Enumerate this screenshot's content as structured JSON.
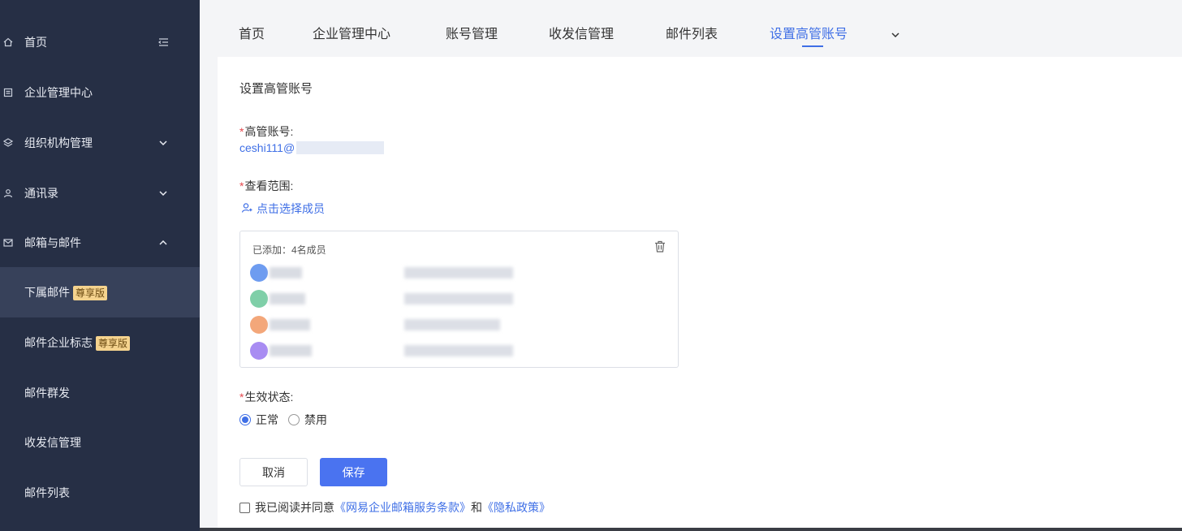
{
  "sidebar": {
    "items": [
      {
        "label": "首页",
        "icon": "home-icon",
        "right_icon": "menu-collapse-icon"
      },
      {
        "label": "企业管理中心",
        "icon": "document-icon"
      },
      {
        "label": "组织机构管理",
        "icon": "layers-icon",
        "right_icon": "chevron-down-icon"
      },
      {
        "label": "通讯录",
        "icon": "contacts-icon",
        "right_icon": "chevron-down-icon"
      },
      {
        "label": "邮箱与邮件",
        "icon": "mail-icon",
        "right_icon": "chevron-up-icon"
      }
    ],
    "sub_items": [
      {
        "label": "下属邮件",
        "badge": "尊享版",
        "active": true
      },
      {
        "label": "邮件企业标志",
        "badge": "尊享版"
      },
      {
        "label": "邮件群发"
      },
      {
        "label": "收发信管理"
      },
      {
        "label": "邮件列表"
      }
    ]
  },
  "tabs": {
    "items": [
      "首页",
      "企业管理中心",
      "账号管理",
      "收发信管理",
      "邮件列表",
      "设置高管账号"
    ],
    "active": "设置高管账号"
  },
  "form": {
    "page_title": "设置高管账号",
    "required_mark": "*",
    "exec_account_label": "高管账号:",
    "exec_account_value": "ceshi111@",
    "view_scope_label": "查看范围:",
    "select_members_link": "点击选择成员",
    "members_added_text": "已添加：4名成员",
    "status_label": "生效状态:",
    "status_options": [
      "正常",
      "禁用"
    ],
    "status_selected": "正常",
    "cancel_button": "取消",
    "save_button": "保存",
    "agree_prefix": "我已阅读并同意",
    "agree_terms": "《网易企业邮箱服务条款》",
    "agree_and": "和",
    "agree_privacy": "《隐私政策》"
  },
  "colors": {
    "sidebar_bg": "#262f45",
    "accent": "#3f6fe6",
    "badge_bg": "#f5d38e",
    "avatar_colors": [
      "#6e9cf0",
      "#7fcfa8",
      "#f3a77a",
      "#a88cf2"
    ]
  }
}
